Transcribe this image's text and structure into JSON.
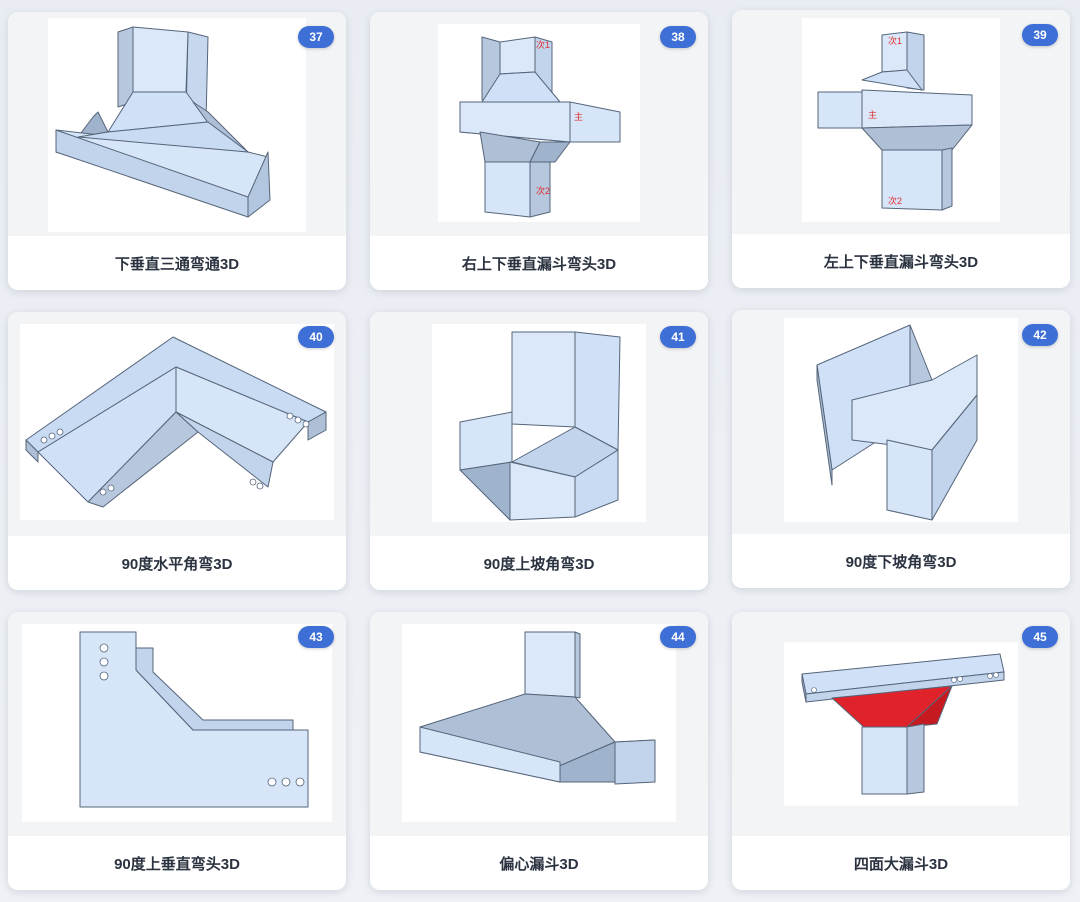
{
  "cards": [
    {
      "number": "37",
      "title": "下垂直三通弯通3D"
    },
    {
      "number": "38",
      "title": "右上下垂直漏斗弯头3D",
      "labels": [
        "次1",
        "主",
        "次2"
      ]
    },
    {
      "number": "39",
      "title": "左上下垂直漏斗弯头3D",
      "labels": [
        "次1",
        "主",
        "次2"
      ]
    },
    {
      "number": "40",
      "title": "90度水平角弯3D"
    },
    {
      "number": "41",
      "title": "90度上坡角弯3D"
    },
    {
      "number": "42",
      "title": "90度下坡角弯3D"
    },
    {
      "number": "43",
      "title": "90度上垂直弯头3D"
    },
    {
      "number": "44",
      "title": "偏心漏斗3D"
    },
    {
      "number": "45",
      "title": "四面大漏斗3D"
    }
  ],
  "colors": {
    "badge": "#3e6fd6",
    "sheet_metal": "#cfe0f7",
    "sheet_metal_shade": "#9fb3cc",
    "funnel_red": "#e0232a",
    "label_red": "#e03030"
  },
  "icons": {
    "model": "3d-model-preview-icon"
  }
}
